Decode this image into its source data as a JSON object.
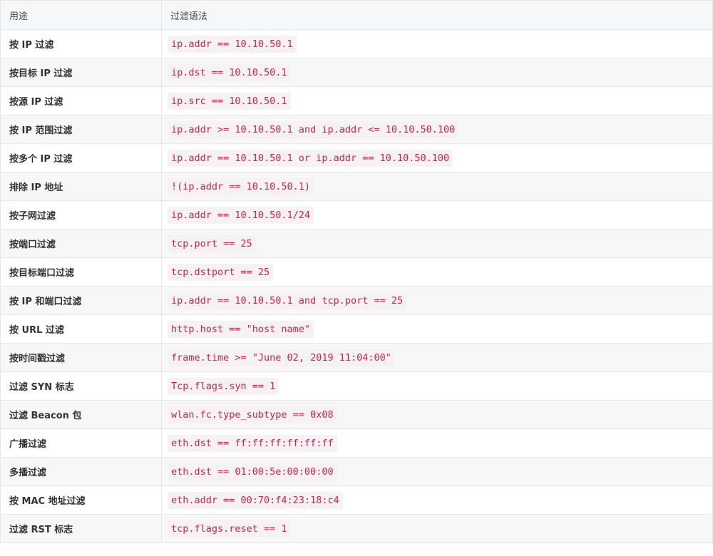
{
  "header": {
    "col_purpose": "用途",
    "col_syntax": "过滤语法"
  },
  "rows": [
    {
      "purpose": "按 IP 过滤",
      "syntax": "ip.addr == 10.10.50.1"
    },
    {
      "purpose": "按目标 IP 过滤",
      "syntax": "ip.dst == 10.10.50.1"
    },
    {
      "purpose": "按源 IP 过滤",
      "syntax": "ip.src == 10.10.50.1"
    },
    {
      "purpose": "按 IP 范围过滤",
      "syntax": "ip.addr >= 10.10.50.1 and ip.addr <= 10.10.50.100"
    },
    {
      "purpose": "按多个 IP 过滤",
      "syntax": "ip.addr == 10.10.50.1 or ip.addr == 10.10.50.100"
    },
    {
      "purpose": "排除 IP 地址",
      "syntax": "!(ip.addr == 10.10.50.1)"
    },
    {
      "purpose": "按子网过滤",
      "syntax": "ip.addr == 10.10.50.1/24"
    },
    {
      "purpose": "按端口过滤",
      "syntax": "tcp.port == 25"
    },
    {
      "purpose": "按目标端口过滤",
      "syntax": "tcp.dstport == 25"
    },
    {
      "purpose": "按 IP 和端口过滤",
      "syntax": "ip.addr == 10.10.50.1 and tcp.port == 25"
    },
    {
      "purpose": "按 URL 过滤",
      "syntax": "http.host == \"host name\""
    },
    {
      "purpose": "按时间戳过滤",
      "syntax": "frame.time >= \"June 02, 2019 11:04:00\""
    },
    {
      "purpose": "过滤 SYN 标志",
      "syntax": "Tcp.flags.syn == 1"
    },
    {
      "purpose": "过滤 Beacon 包",
      "syntax": "wlan.fc.type_subtype == 0x08"
    },
    {
      "purpose": "广播过滤",
      "syntax": "eth.dst == ff:ff:ff:ff:ff:ff"
    },
    {
      "purpose": "多播过滤",
      "syntax": "eth.dst == 01:00:5e:00:00:00"
    },
    {
      "purpose": "按 MAC 地址过滤",
      "syntax": "eth.addr == 00:70:f4:23:18:c4"
    },
    {
      "purpose": "过滤 RST 标志",
      "syntax": "tcp.flags.reset == 1"
    }
  ]
}
